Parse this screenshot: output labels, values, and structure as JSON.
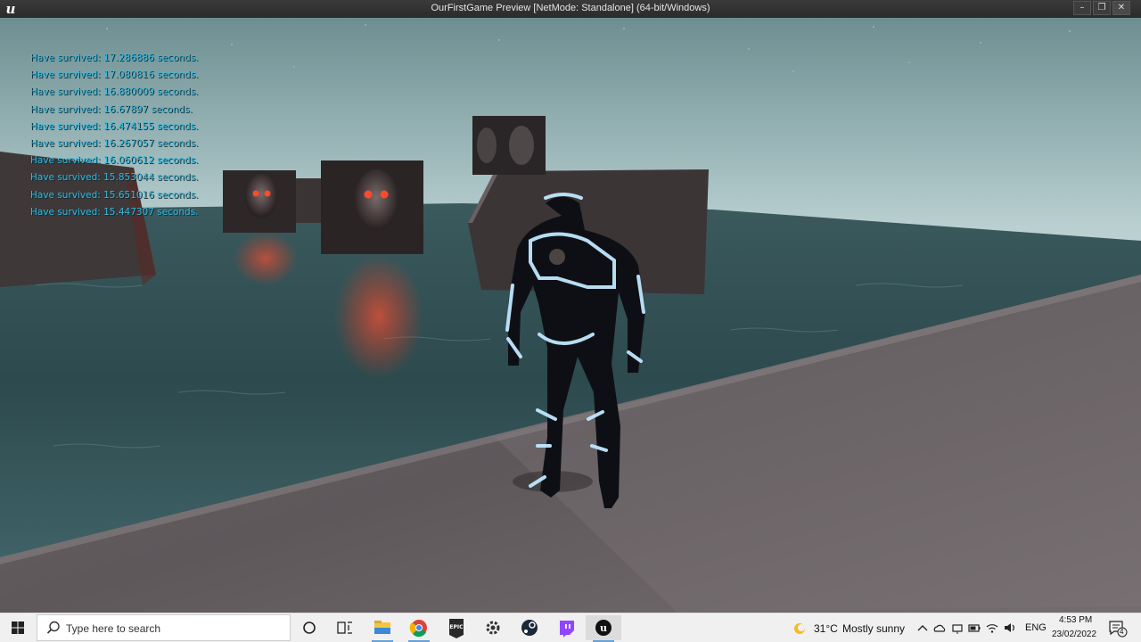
{
  "window": {
    "title": "OurFirstGame Preview [NetMode: Standalone]  (64-bit/Windows)",
    "logo_letter": "u",
    "buttons": {
      "minimize": "–",
      "restore": "❐",
      "close": "✕"
    }
  },
  "hud": {
    "color": "#35b9df",
    "messages": [
      "Have survived: 17.286886 seconds.",
      "Have survived: 17.080816 seconds.",
      "Have survived: 16.880009 seconds.",
      "Have survived: 16.67897 seconds.",
      "Have survived: 16.474155 seconds.",
      "Have survived: 16.267057 seconds.",
      "Have survived: 16.060612 seconds.",
      "Have survived: 15.853044 seconds.",
      "Have survived: 15.651016 seconds.",
      "Have survived: 15.447307 seconds."
    ]
  },
  "taskbar": {
    "search_placeholder": "Type here to search",
    "apps": [
      {
        "name": "cortana-icon",
        "active": false
      },
      {
        "name": "task-view-icon",
        "active": false
      },
      {
        "name": "file-explorer-icon",
        "active": false,
        "open": true
      },
      {
        "name": "chrome-icon",
        "active": false,
        "open": true
      },
      {
        "name": "epic-games-icon",
        "active": false
      },
      {
        "name": "settings-icon",
        "active": false
      },
      {
        "name": "steam-icon",
        "active": false
      },
      {
        "name": "twitch-icon",
        "active": false
      },
      {
        "name": "unreal-engine-icon",
        "active": true,
        "open": true
      }
    ],
    "weather": {
      "temp": "31°C",
      "condition": "Mostly sunny"
    },
    "language": "ENG",
    "time": "4:53 PM",
    "date": "23/02/2022",
    "notification_count": "4"
  }
}
